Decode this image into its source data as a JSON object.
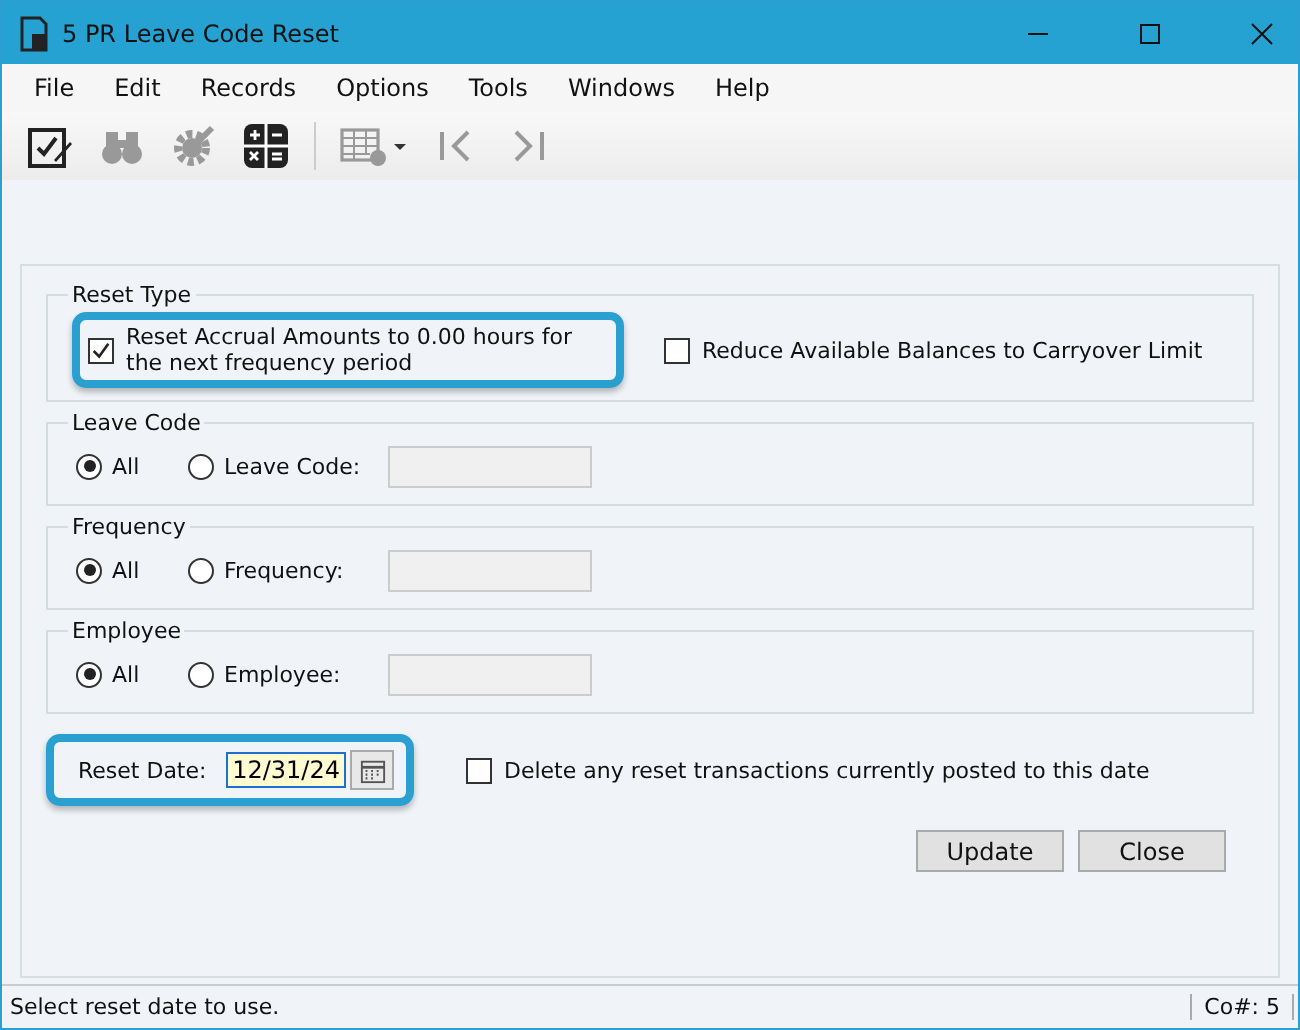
{
  "window": {
    "title": "5 PR Leave Code Reset"
  },
  "menu": [
    "File",
    "Edit",
    "Records",
    "Options",
    "Tools",
    "Windows",
    "Help"
  ],
  "toolbar": [
    {
      "kind": "edit",
      "disabled": false
    },
    {
      "kind": "find",
      "disabled": true
    },
    {
      "kind": "gear",
      "disabled": true
    },
    {
      "kind": "calc",
      "disabled": false
    },
    {
      "kind": "separator"
    },
    {
      "kind": "grid",
      "disabled": true
    },
    {
      "kind": "first",
      "disabled": true
    },
    {
      "kind": "last",
      "disabled": true
    }
  ],
  "reset_type": {
    "legend": "Reset Type",
    "options": [
      {
        "label": "Reset Accrual Amounts to 0.00 hours for the next frequency period",
        "checked": true,
        "highlighted": true
      },
      {
        "label": "Reduce Available Balances to Carryover Limit",
        "checked": false,
        "highlighted": false
      }
    ]
  },
  "groups": [
    {
      "legend": "Leave Code",
      "radios": [
        {
          "label": "All",
          "selected": true
        },
        {
          "label": "Leave Code:",
          "selected": false
        }
      ]
    },
    {
      "legend": "Frequency",
      "radios": [
        {
          "label": "All",
          "selected": true
        },
        {
          "label": "Frequency:",
          "selected": false
        }
      ]
    },
    {
      "legend": "Employee",
      "radios": [
        {
          "label": "All",
          "selected": true
        },
        {
          "label": "Employee:",
          "selected": false
        }
      ]
    }
  ],
  "reset_date": {
    "label": "Reset Date:",
    "value": "12/31/24",
    "highlighted": true
  },
  "delete_option": {
    "label": "Delete any reset transactions currently posted to this date",
    "checked": false
  },
  "buttons": [
    "Update",
    "Close"
  ],
  "status_bar": {
    "message": "Select reset date to use.",
    "company": "Co#: 5"
  }
}
